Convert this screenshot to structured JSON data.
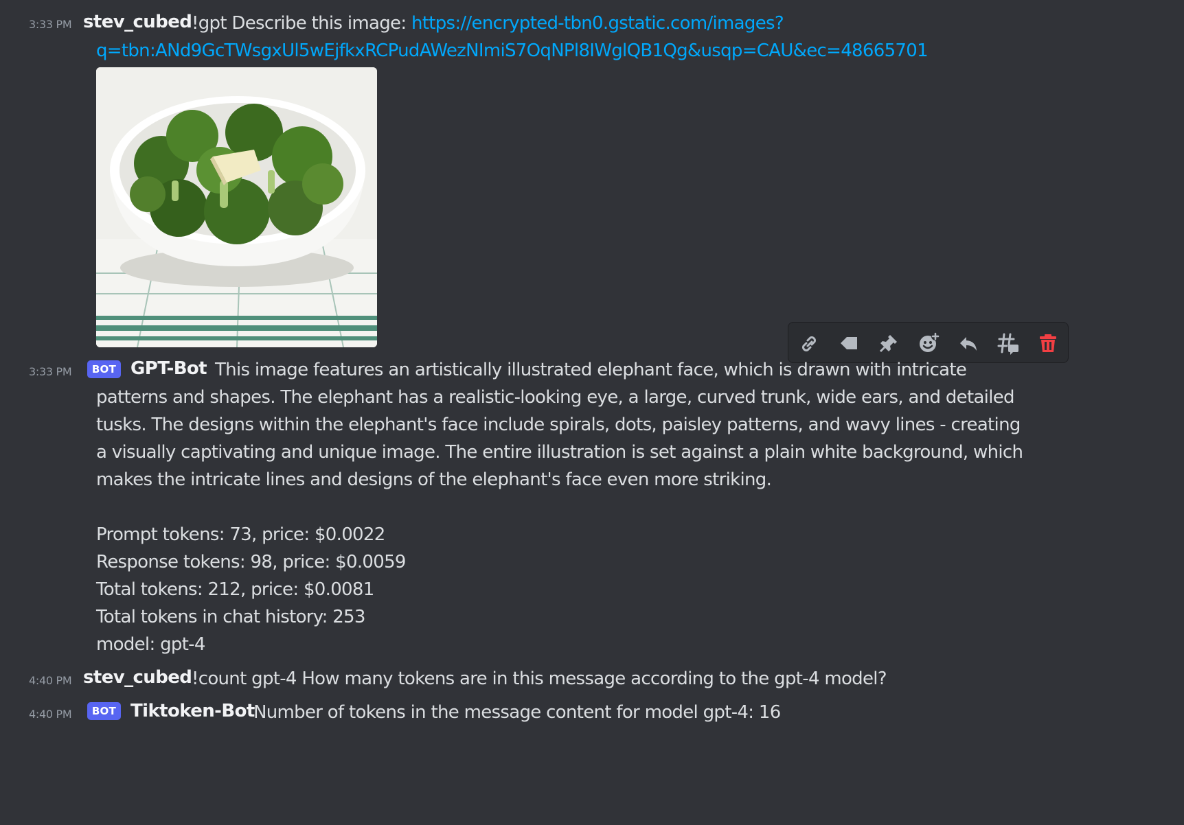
{
  "messages": {
    "m1": {
      "timestamp": "3:33 PM",
      "author": "stev_cubed",
      "text": "!gpt Describe this image: ",
      "link_line1": "https://encrypted-tbn0.gstatic.com/images?",
      "link_line2": "q=tbn:ANd9GcTWsgxUl5wEjfkxRCPudAWezNImiS7OqNPl8IWglQB1Qg&usqp=CAU&ec=48665701",
      "attachment_icon": "broccoli-bowl-image"
    },
    "m2": {
      "timestamp": "3:33 PM",
      "badge": "BOT",
      "author": "GPT-Bot",
      "lines": [
        "This image features an artistically illustrated elephant face, which is drawn with intricate",
        "patterns and shapes. The elephant has a realistic-looking eye, a large, curved trunk, wide ears, and detailed",
        "tusks. The designs within the elephant's face include spirals, dots, paisley patterns, and wavy lines - creating",
        "a visually captivating and unique image. The entire illustration is set against a plain white background, which",
        "makes the intricate lines and designs of the elephant's face even more striking."
      ],
      "stats": [
        "Prompt tokens: 73, price: $0.0022",
        "Response tokens: 98, price: $0.0059",
        "Total tokens: 212, price: $0.0081",
        "Total tokens in chat history: 253",
        "model: gpt-4"
      ]
    },
    "m3": {
      "timestamp": "4:40 PM",
      "author": "stev_cubed",
      "text": "!count gpt-4 How many tokens are in this message according to the gpt-4 model?"
    },
    "m4": {
      "timestamp": "4:40 PM",
      "badge": "BOT",
      "author": "Tiktoken-Bot",
      "text": "Number of tokens in the message content for model gpt-4: 16"
    }
  },
  "toolbar_icons": [
    "link-icon",
    "tag-icon",
    "pin-icon",
    "add-reaction-icon",
    "reply-icon",
    "create-thread-icon",
    "delete-icon"
  ],
  "colors": {
    "background": "#313338",
    "link": "#00a8fc",
    "bot_badge": "#5865f2",
    "delete": "#f23f43",
    "muted": "#949ba4"
  }
}
